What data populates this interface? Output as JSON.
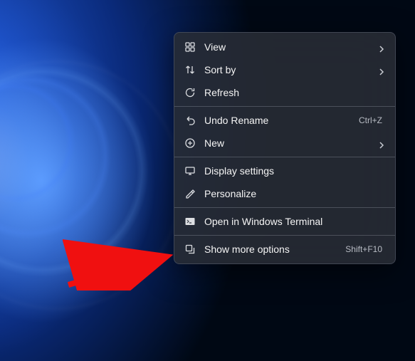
{
  "menu": {
    "view": {
      "label": "View"
    },
    "sort_by": {
      "label": "Sort by"
    },
    "refresh": {
      "label": "Refresh"
    },
    "undo_rename": {
      "label": "Undo Rename",
      "shortcut": "Ctrl+Z"
    },
    "new": {
      "label": "New"
    },
    "display_settings": {
      "label": "Display settings"
    },
    "personalize": {
      "label": "Personalize"
    },
    "open_terminal": {
      "label": "Open in Windows Terminal"
    },
    "show_more": {
      "label": "Show more options",
      "shortcut": "Shift+F10"
    }
  }
}
